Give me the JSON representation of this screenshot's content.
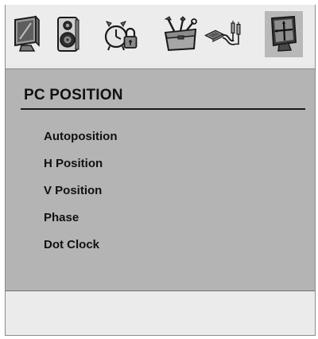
{
  "osd": {
    "tabs": [
      {
        "name": "display-tab",
        "icon": "monitor-icon",
        "active": false
      },
      {
        "name": "audio-tab",
        "icon": "speaker-icon",
        "active": false
      },
      {
        "name": "timer-lock-tab",
        "icon": "clock-lock-icon",
        "active": false
      },
      {
        "name": "tools-tab",
        "icon": "toolbox-icon",
        "active": false
      },
      {
        "name": "connections-tab",
        "icon": "cable-plug-icon",
        "active": false
      },
      {
        "name": "pc-tab",
        "icon": "pc-position-icon",
        "active": true
      }
    ],
    "menu": {
      "title": "PC POSITION",
      "items": [
        {
          "label": "Autoposition"
        },
        {
          "label": "H Position"
        },
        {
          "label": "V Position"
        },
        {
          "label": "Phase"
        },
        {
          "label": "Dot Clock"
        }
      ]
    }
  }
}
